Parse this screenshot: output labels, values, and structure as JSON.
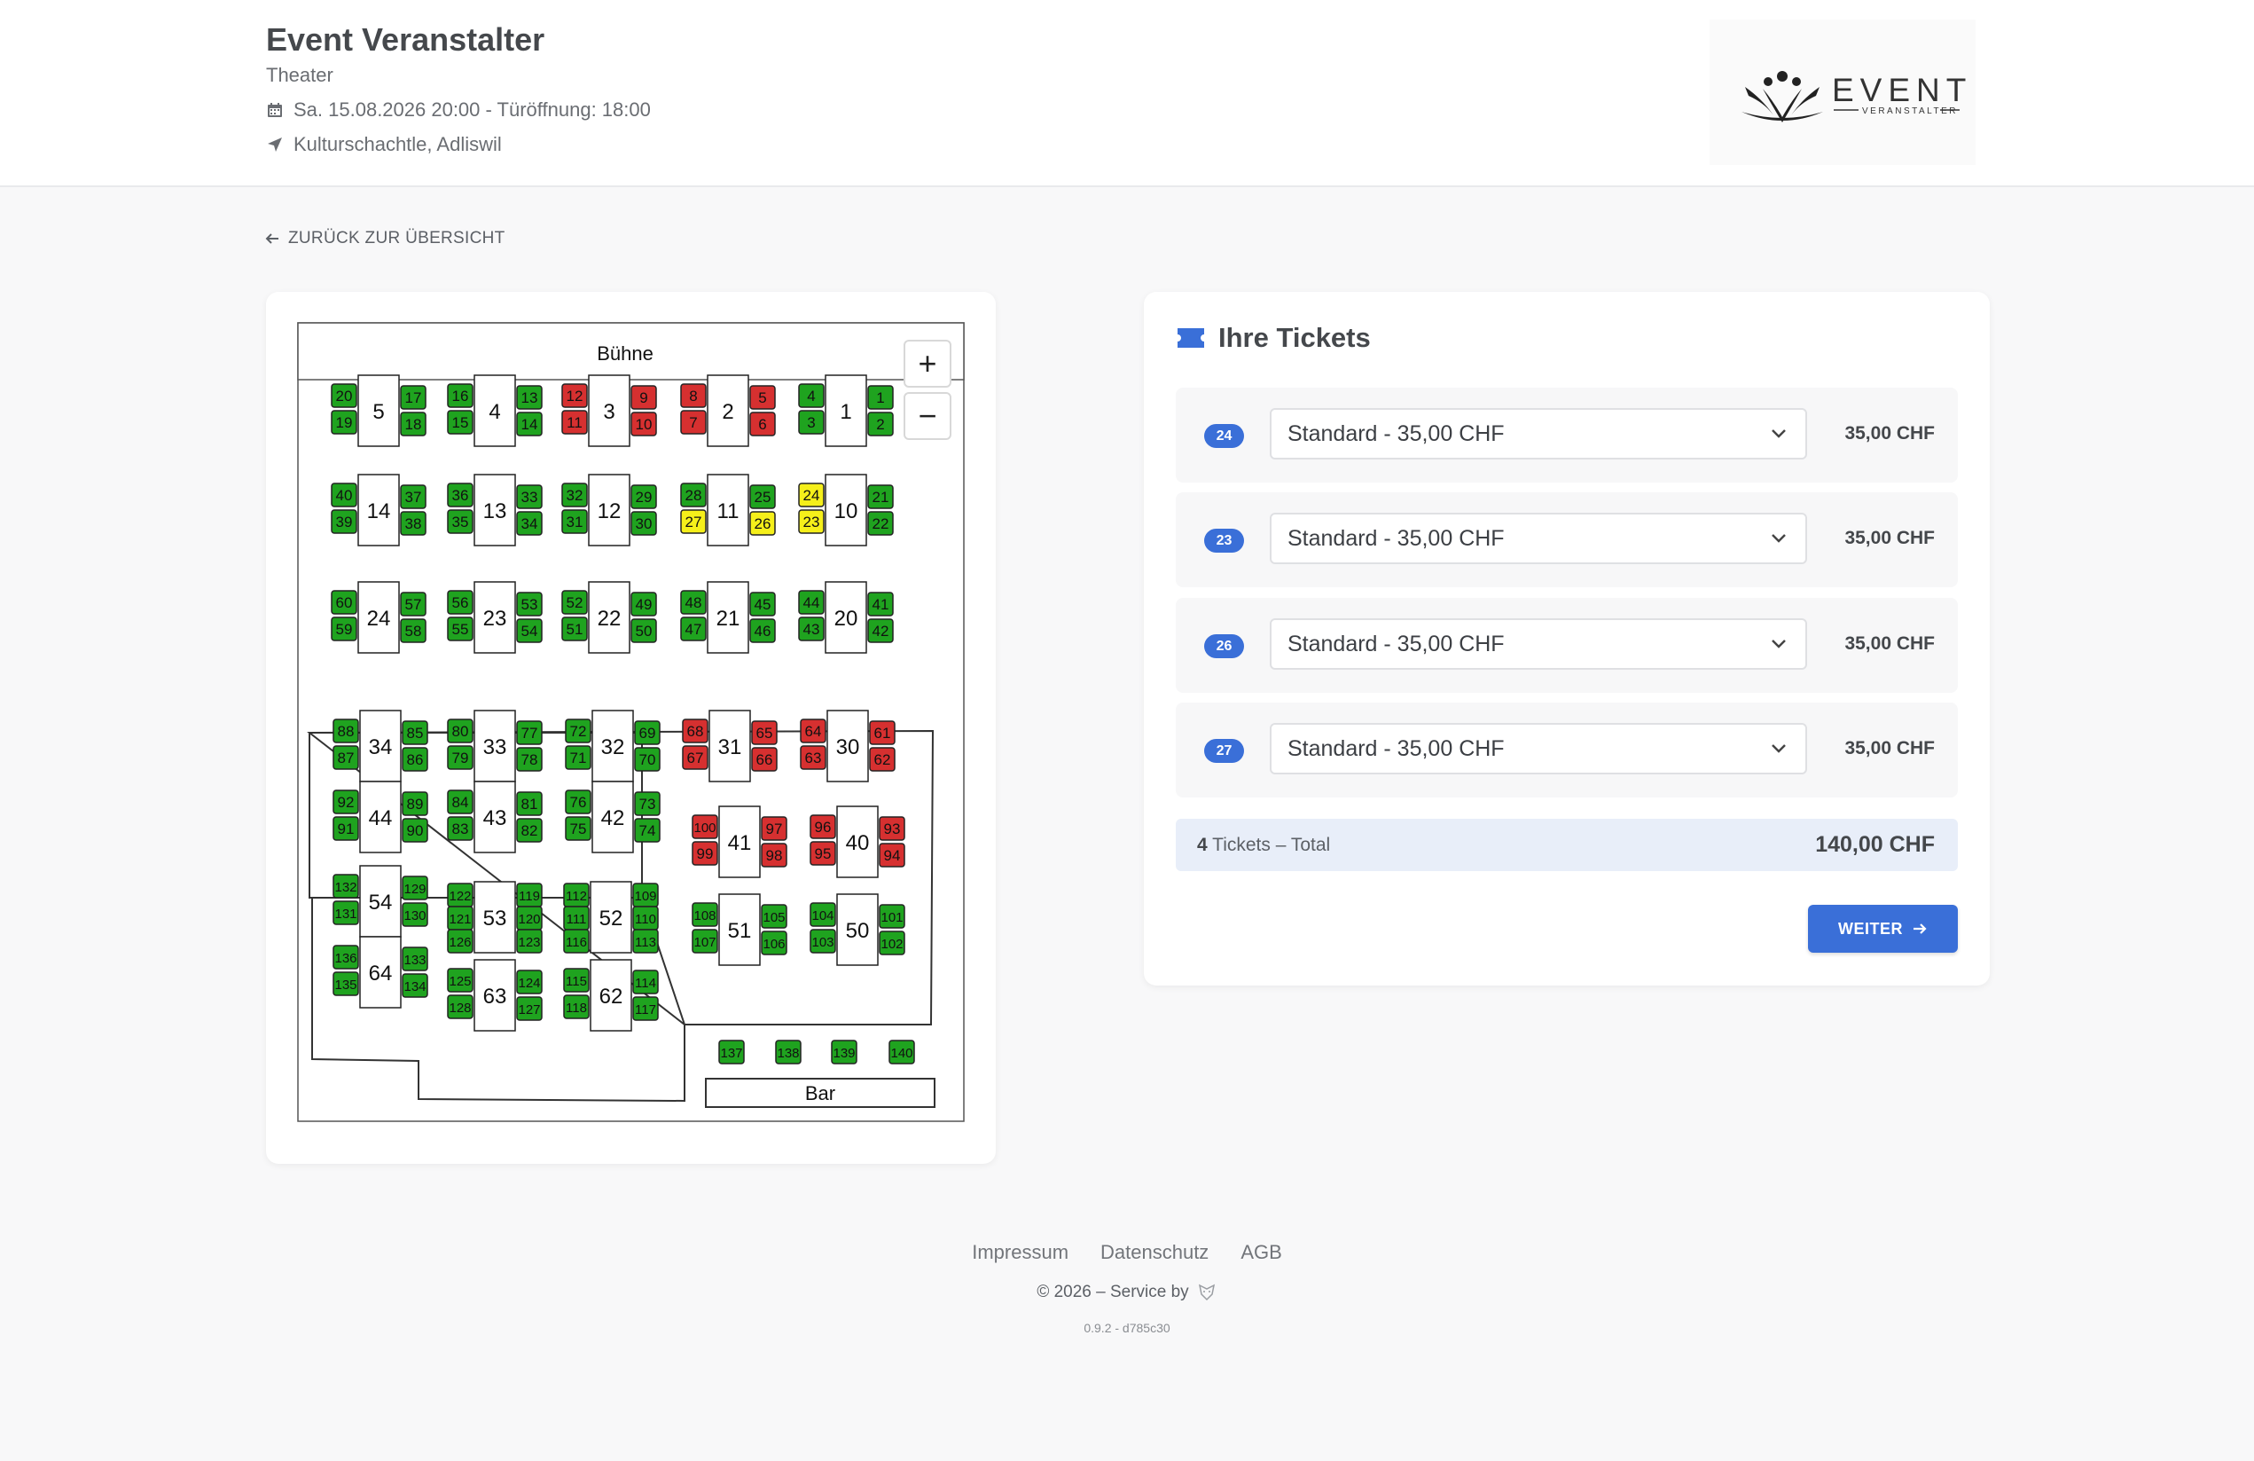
{
  "header": {
    "title": "Event Veranstalter",
    "subtitle": "Theater",
    "date_line": "Sa. 15.08.2026 20:00 - Türöffnung: 18:00",
    "location": "Kulturschachtle, Adliswil",
    "logo": {
      "word": "EVENT",
      "tagline": "VERANSTALTER"
    }
  },
  "back_label": "ZURÜCK ZUR ÜBERSICHT",
  "seatmap": {
    "stage_label": "Bühne",
    "bar_label": "Bar",
    "zoom_in": "+",
    "zoom_out": "−",
    "colors": {
      "available": "#1fa31f",
      "taken": "#d63030",
      "selected": "#f5ef1a",
      "table": "#ffffff"
    },
    "tables": [
      {
        "n": "5",
        "seats": [
          [
            "20",
            "available"
          ],
          [
            "19",
            "available"
          ],
          [
            "17",
            "available"
          ],
          [
            "18",
            "available"
          ]
        ]
      },
      {
        "n": "4",
        "seats": [
          [
            "16",
            "available"
          ],
          [
            "15",
            "available"
          ],
          [
            "13",
            "available"
          ],
          [
            "14",
            "available"
          ]
        ]
      },
      {
        "n": "3",
        "seats": [
          [
            "12",
            "taken"
          ],
          [
            "11",
            "taken"
          ],
          [
            "9",
            "taken"
          ],
          [
            "10",
            "taken"
          ]
        ]
      },
      {
        "n": "2",
        "seats": [
          [
            "8",
            "taken"
          ],
          [
            "7",
            "taken"
          ],
          [
            "5",
            "taken"
          ],
          [
            "6",
            "taken"
          ]
        ]
      },
      {
        "n": "1",
        "seats": [
          [
            "4",
            "available"
          ],
          [
            "3",
            "available"
          ],
          [
            "1",
            "available"
          ],
          [
            "2",
            "available"
          ]
        ]
      },
      {
        "n": "14",
        "seats": [
          [
            "40",
            "available"
          ],
          [
            "39",
            "available"
          ],
          [
            "37",
            "available"
          ],
          [
            "38",
            "available"
          ]
        ]
      },
      {
        "n": "13",
        "seats": [
          [
            "36",
            "available"
          ],
          [
            "35",
            "available"
          ],
          [
            "33",
            "available"
          ],
          [
            "34",
            "available"
          ]
        ]
      },
      {
        "n": "12",
        "seats": [
          [
            "32",
            "available"
          ],
          [
            "31",
            "available"
          ],
          [
            "29",
            "available"
          ],
          [
            "30",
            "available"
          ]
        ]
      },
      {
        "n": "11",
        "seats": [
          [
            "28",
            "available"
          ],
          [
            "27",
            "selected"
          ],
          [
            "25",
            "available"
          ],
          [
            "26",
            "selected"
          ]
        ]
      },
      {
        "n": "10",
        "seats": [
          [
            "24",
            "selected"
          ],
          [
            "23",
            "selected"
          ],
          [
            "21",
            "available"
          ],
          [
            "22",
            "available"
          ]
        ]
      },
      {
        "n": "24",
        "seats": [
          [
            "60",
            "available"
          ],
          [
            "59",
            "available"
          ],
          [
            "57",
            "available"
          ],
          [
            "58",
            "available"
          ]
        ]
      },
      {
        "n": "23",
        "seats": [
          [
            "56",
            "available"
          ],
          [
            "55",
            "available"
          ],
          [
            "53",
            "available"
          ],
          [
            "54",
            "available"
          ]
        ]
      },
      {
        "n": "22",
        "seats": [
          [
            "52",
            "available"
          ],
          [
            "51",
            "available"
          ],
          [
            "49",
            "available"
          ],
          [
            "50",
            "available"
          ]
        ]
      },
      {
        "n": "21",
        "seats": [
          [
            "48",
            "available"
          ],
          [
            "47",
            "available"
          ],
          [
            "45",
            "available"
          ],
          [
            "46",
            "available"
          ]
        ]
      },
      {
        "n": "20",
        "seats": [
          [
            "44",
            "available"
          ],
          [
            "43",
            "available"
          ],
          [
            "41",
            "available"
          ],
          [
            "42",
            "available"
          ]
        ]
      },
      {
        "n": "34",
        "seats": [
          [
            "88",
            "available"
          ],
          [
            "87",
            "available"
          ],
          [
            "85",
            "available"
          ],
          [
            "86",
            "available"
          ]
        ]
      },
      {
        "n": "33",
        "seats": [
          [
            "80",
            "available"
          ],
          [
            "79",
            "available"
          ],
          [
            "77",
            "available"
          ],
          [
            "78",
            "available"
          ]
        ]
      },
      {
        "n": "32",
        "seats": [
          [
            "72",
            "available"
          ],
          [
            "71",
            "available"
          ],
          [
            "69",
            "available"
          ],
          [
            "70",
            "available"
          ]
        ]
      },
      {
        "n": "31",
        "seats": [
          [
            "68",
            "taken"
          ],
          [
            "67",
            "taken"
          ],
          [
            "65",
            "taken"
          ],
          [
            "66",
            "taken"
          ]
        ]
      },
      {
        "n": "30",
        "seats": [
          [
            "64",
            "taken"
          ],
          [
            "63",
            "taken"
          ],
          [
            "61",
            "taken"
          ],
          [
            "62",
            "taken"
          ]
        ]
      },
      {
        "n": "44",
        "seats": [
          [
            "92",
            "available"
          ],
          [
            "91",
            "available"
          ],
          [
            "89",
            "available"
          ],
          [
            "90",
            "available"
          ]
        ]
      },
      {
        "n": "43",
        "seats": [
          [
            "84",
            "available"
          ],
          [
            "83",
            "available"
          ],
          [
            "81",
            "available"
          ],
          [
            "82",
            "available"
          ]
        ]
      },
      {
        "n": "42",
        "seats": [
          [
            "76",
            "available"
          ],
          [
            "75",
            "available"
          ],
          [
            "73",
            "available"
          ],
          [
            "74",
            "available"
          ]
        ]
      },
      {
        "n": "41",
        "seats": [
          [
            "100",
            "taken"
          ],
          [
            "99",
            "taken"
          ],
          [
            "97",
            "taken"
          ],
          [
            "98",
            "taken"
          ]
        ]
      },
      {
        "n": "40",
        "seats": [
          [
            "96",
            "taken"
          ],
          [
            "95",
            "taken"
          ],
          [
            "93",
            "taken"
          ],
          [
            "94",
            "taken"
          ]
        ]
      },
      {
        "n": "54",
        "seats": [
          [
            "132",
            "available"
          ],
          [
            "131",
            "available"
          ],
          [
            "129",
            "available"
          ],
          [
            "130",
            "available"
          ]
        ]
      },
      {
        "n": "53",
        "seats": [
          [
            "122",
            "available"
          ],
          [
            "121",
            "available"
          ],
          [
            "126",
            "available"
          ],
          [
            "119",
            "available"
          ],
          [
            "120",
            "available"
          ],
          [
            "123",
            "available"
          ]
        ]
      },
      {
        "n": "52",
        "seats": [
          [
            "112",
            "available"
          ],
          [
            "111",
            "available"
          ],
          [
            "116",
            "available"
          ],
          [
            "109",
            "available"
          ],
          [
            "110",
            "available"
          ],
          [
            "113",
            "available"
          ]
        ]
      },
      {
        "n": "51",
        "seats": [
          [
            "108",
            "available"
          ],
          [
            "107",
            "available"
          ],
          [
            "105",
            "available"
          ],
          [
            "106",
            "available"
          ]
        ]
      },
      {
        "n": "50",
        "seats": [
          [
            "104",
            "available"
          ],
          [
            "103",
            "available"
          ],
          [
            "101",
            "available"
          ],
          [
            "102",
            "available"
          ]
        ]
      },
      {
        "n": "64",
        "seats": [
          [
            "136",
            "available"
          ],
          [
            "135",
            "available"
          ],
          [
            "133",
            "available"
          ],
          [
            "134",
            "available"
          ]
        ]
      },
      {
        "n": "63",
        "seats": [
          [
            "125",
            "available"
          ],
          [
            "128",
            "available"
          ],
          [
            "124",
            "available"
          ],
          [
            "127",
            "available"
          ]
        ]
      },
      {
        "n": "62",
        "seats": [
          [
            "115",
            "available"
          ],
          [
            "118",
            "available"
          ],
          [
            "114",
            "available"
          ],
          [
            "117",
            "available"
          ]
        ]
      }
    ],
    "bar_seats": [
      [
        "137",
        "available"
      ],
      [
        "138",
        "available"
      ],
      [
        "139",
        "available"
      ],
      [
        "140",
        "available"
      ]
    ]
  },
  "tickets": {
    "title": "Ihre Tickets",
    "items": [
      {
        "seat": "24",
        "option": "Standard - 35,00 CHF",
        "price": "35,00 CHF"
      },
      {
        "seat": "23",
        "option": "Standard - 35,00 CHF",
        "price": "35,00 CHF"
      },
      {
        "seat": "26",
        "option": "Standard - 35,00 CHF",
        "price": "35,00 CHF"
      },
      {
        "seat": "27",
        "option": "Standard - 35,00 CHF",
        "price": "35,00 CHF"
      }
    ],
    "total_count": "4",
    "total_label": "Tickets – Total",
    "total_price": "140,00 CHF",
    "next_label": "WEITER"
  },
  "footer": {
    "links": [
      "Impressum",
      "Datenschutz",
      "AGB"
    ],
    "copyright": "© 2026 – Service by",
    "version": "0.9.2 - d785c30"
  }
}
